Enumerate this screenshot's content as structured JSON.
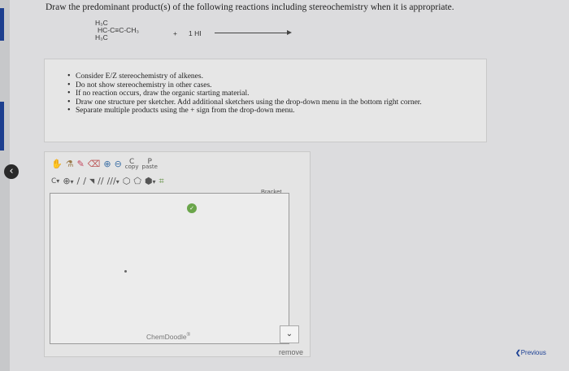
{
  "question": "Draw the predominant product(s) of the following reactions including stereochemistry when it is appropriate.",
  "reaction": {
    "reactant_line1": "H₃C",
    "reactant_line2": "HC-C≡C-CH₃",
    "reactant_line3": "H₃C",
    "plus": "+",
    "reagent": "1 HI"
  },
  "instructions": [
    "Consider E/Z stereochemistry of alkenes.",
    "Do not show stereochemistry in other cases.",
    "If no reaction occurs, draw the organic starting material.",
    "Draw one structure per sketcher. Add additional sketchers using the drop-down menu in the bottom right corner.",
    "Separate multiple products using the + sign from the drop-down menu."
  ],
  "sketcher": {
    "row1": {
      "hand_icon": "✋",
      "flask_icon": "⚗",
      "pencil_icon": "✎",
      "eraser_icon": "⌫",
      "zoom_in_icon": "⊕",
      "zoom_out_icon": "⊖",
      "copy_letter": "C",
      "copy_label": "copy",
      "paste_letter": "P",
      "paste_label": "paste"
    },
    "row2": {
      "element_label": "C",
      "element_arrow": "▾",
      "charge_icon": "⊕",
      "charge_arrow": "▾",
      "single_bond": "/",
      "dashed_bond": "∕",
      "wedge_bond": "◥",
      "double_bond": "//",
      "triple_bond": "///",
      "bond_arrow": "▾",
      "ring1": "⬡",
      "ring2": "⬠",
      "ring3": "⬢",
      "ring_arrow": "▾",
      "template_icon": "⌗"
    },
    "bracket_label": "Bracket",
    "green_badge": "✓",
    "brand": "ChemDoodle",
    "brand_sup": "®"
  },
  "add_dropdown_chevron": "⌄",
  "remove_label": "remove",
  "previous_chevron": "❮",
  "previous_label": "Previous",
  "colors": {
    "background": "#dcdcde",
    "panel": "#e6e6e6",
    "edge_bar": "#1d3f8f",
    "link": "#1a3f94"
  }
}
